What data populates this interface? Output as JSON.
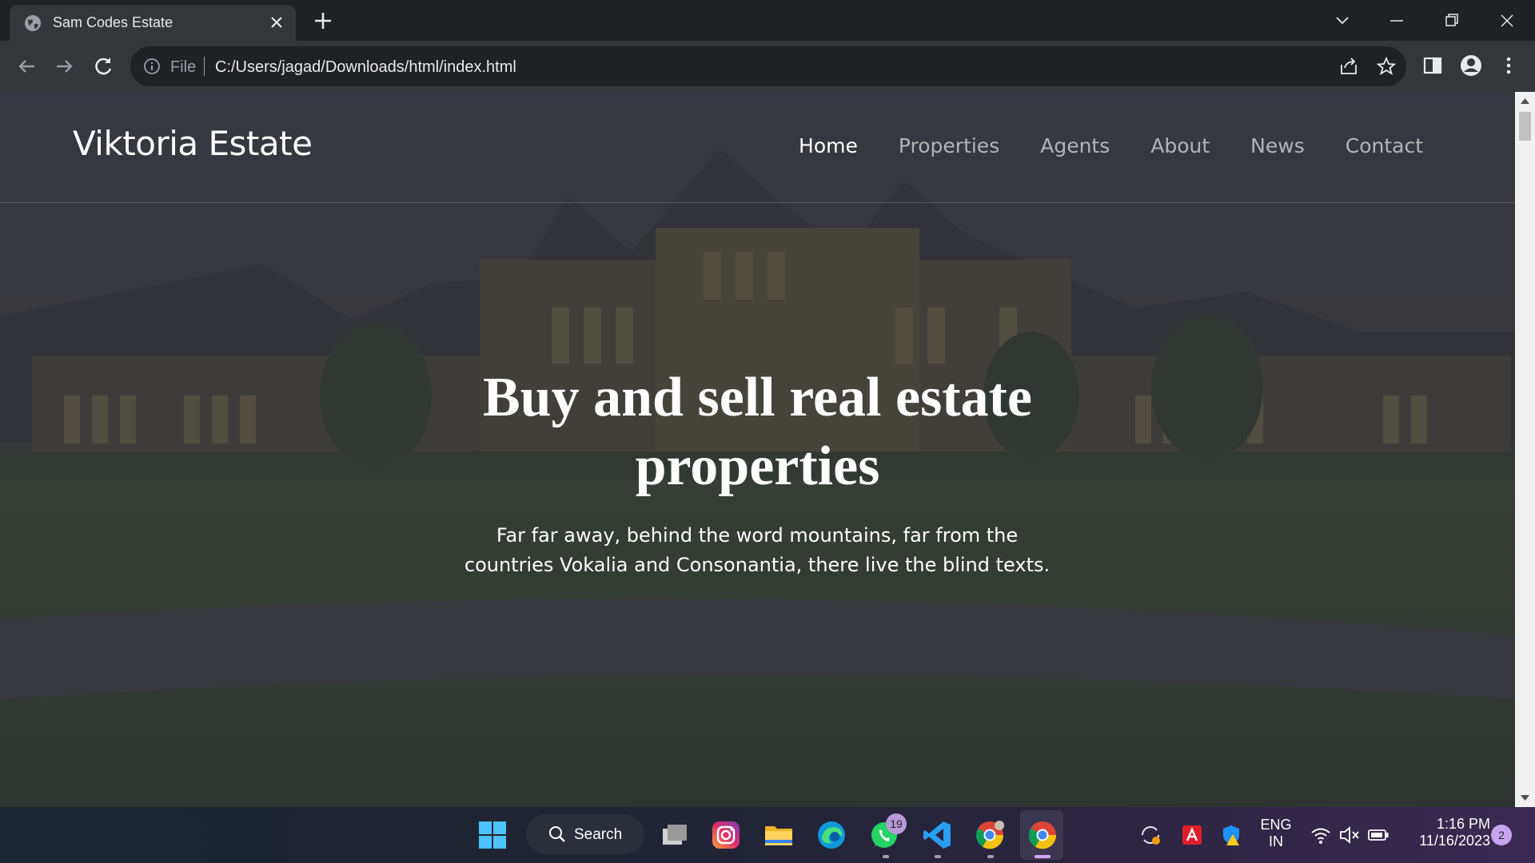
{
  "browser": {
    "tab_title": "Sam Codes Estate",
    "address": {
      "scheme_label": "File",
      "url": "C:/Users/jagad/Downloads/html/index.html"
    }
  },
  "site": {
    "brand": "Viktoria Estate",
    "nav": [
      {
        "label": "Home",
        "active": true
      },
      {
        "label": "Properties",
        "active": false
      },
      {
        "label": "Agents",
        "active": false
      },
      {
        "label": "About",
        "active": false
      },
      {
        "label": "News",
        "active": false
      },
      {
        "label": "Contact",
        "active": false
      }
    ],
    "hero": {
      "title_line1": "Buy and sell real estate",
      "title_line2": "properties",
      "subtitle_line1": "Far far away, behind the word mountains, far from the",
      "subtitle_line2": "countries Vokalia and Consonantia, there live the blind texts."
    }
  },
  "taskbar": {
    "search_label": "Search",
    "whatsapp_badge": "19",
    "language_line1": "ENG",
    "language_line2": "IN",
    "time": "1:16 PM",
    "date": "11/16/2023",
    "notification_count": "2"
  },
  "colors": {
    "chrome_dark": "#202124",
    "chrome_toolbar": "#35363a",
    "hero_overlay": "#2f3138"
  }
}
